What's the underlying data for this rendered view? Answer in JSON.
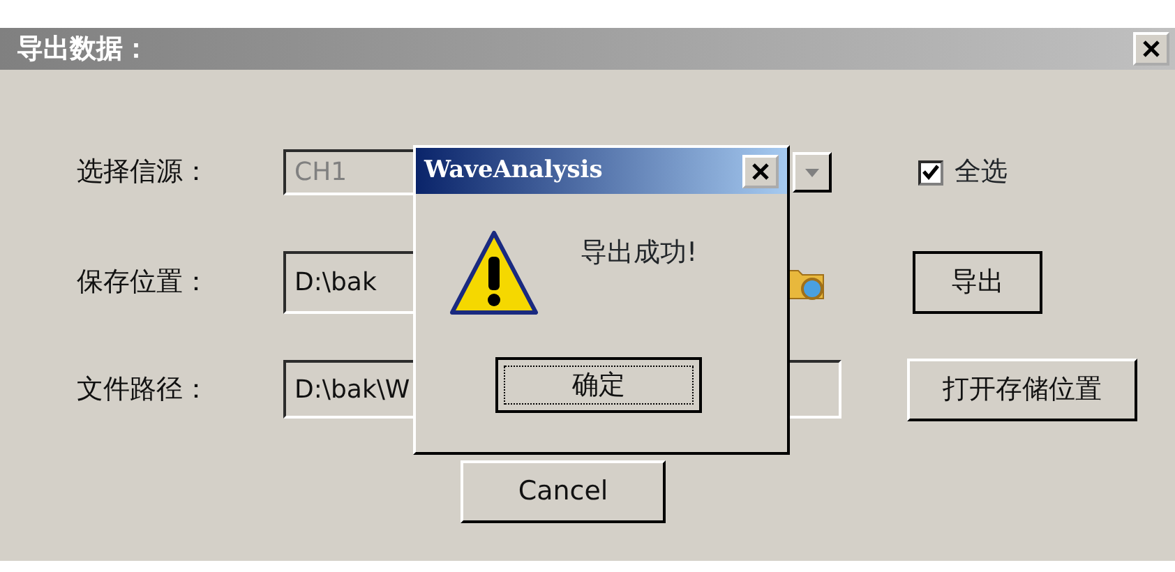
{
  "window": {
    "title": "导出数据："
  },
  "fields": [
    {
      "kind": "combo",
      "label": "选择信源：",
      "value": "CH1",
      "disabled": true
    },
    {
      "kind": "folder",
      "label": "保存位置：",
      "value": "D:\\bak",
      "disabled": false
    },
    {
      "kind": "text",
      "label": "文件路径：",
      "value": "D:\\bak\\W",
      "disabled": false
    }
  ],
  "select_all": {
    "label": "全选",
    "checked": true
  },
  "buttons": [
    {
      "kind": "export",
      "label": "导出"
    },
    {
      "kind": "open",
      "label": "打开存储位置"
    },
    {
      "kind": "cancel",
      "label": "Cancel"
    }
  ],
  "dialog": {
    "title": "WaveAnalysis",
    "message": "导出成功!",
    "button": "确定"
  }
}
